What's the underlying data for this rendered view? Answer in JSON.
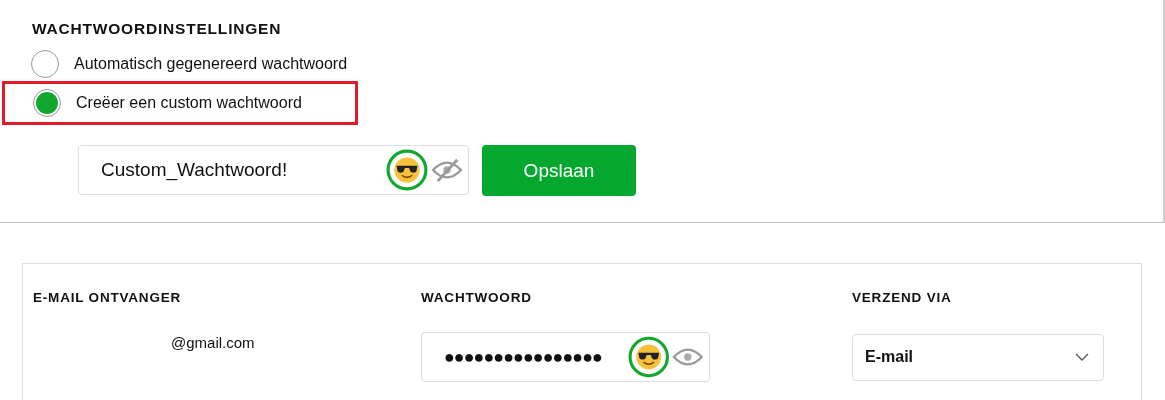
{
  "settings": {
    "title": "WACHTWOORDINSTELLINGEN",
    "options": [
      {
        "label": "Automatisch gegenereerd wachtwoord",
        "selected": false,
        "highlighted": false
      },
      {
        "label": "Creëer een custom wachtwoord",
        "selected": true,
        "highlighted": true
      }
    ],
    "password_field": {
      "value": "Custom_Wachtwoord!",
      "visible": true
    },
    "save_button": "Opslaan"
  },
  "table": {
    "columns": [
      "E-MAIL ONTVANGER",
      "WACHTWOORD",
      "VERZEND VIA"
    ],
    "rows": [
      {
        "recipient": "@gmail.com",
        "password": "●●●●●●●●●●●●●●●●",
        "visible": false,
        "send_via": "E-mail"
      }
    ]
  }
}
